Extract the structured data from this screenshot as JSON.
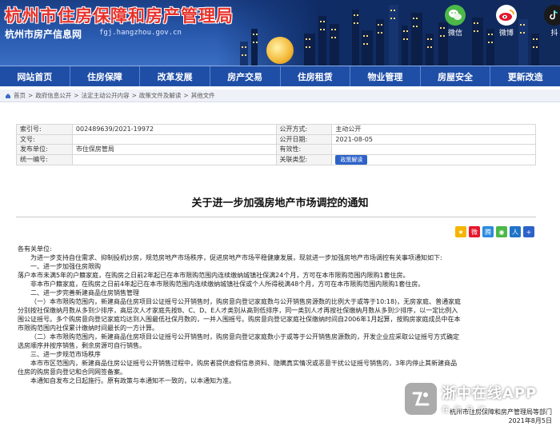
{
  "header": {
    "title": "杭州市住房保障和房产管理局",
    "subtitle": "杭州市房产信息网",
    "url": "fgj.hangzhou.gov.cn",
    "social": [
      {
        "label": "微信",
        "icon": "wechat-icon",
        "color": "#4cb848"
      },
      {
        "label": "微博",
        "icon": "weibo-icon",
        "color": "#e6162d"
      },
      {
        "label": "抖",
        "icon": "douyin-icon",
        "color": "#1a1a1a"
      }
    ]
  },
  "nav": {
    "items": [
      "网站首页",
      "住房保障",
      "改革发展",
      "房产交易",
      "住房租赁",
      "物业管理",
      "房屋安全",
      "更新改造"
    ]
  },
  "breadcrumb": {
    "items": [
      "首页",
      "政府信息公开",
      "法定主动公开内容",
      "政策文件及解读",
      "其他文件"
    ]
  },
  "info": {
    "index_label": "索引号:",
    "index_value": "002489639/2021-19972",
    "public_method_label": "公开方式:",
    "public_method_value": "主动公开",
    "doc_no_label": "文号:",
    "doc_no_value": "",
    "public_date_label": "公开日期:",
    "public_date_value": "2021-08-05",
    "issuer_label": "发布单位:",
    "issuer_value": "市住保房管局",
    "validity_label": "有效性:",
    "validity_value": "",
    "unified_no_label": "统一编号:",
    "unified_no_value": "",
    "related_label": "关联类型:",
    "related_button": "政策解读"
  },
  "doc": {
    "title": "关于进一步加强房地产市场调控的通知",
    "share_icons": [
      "qzone-icon",
      "weibo-icon",
      "tencent-icon",
      "wechat-icon",
      "renren-icon",
      "plus-icon"
    ],
    "paragraphs": [
      "各有关单位:",
      "为进一步支持自住需求、抑制投机炒房，规范房地产市场秩序，促进房地产市场平稳健康发展，现就进一步加强房地产市场调控有关事项通知如下:",
      "一、进一步加强住房限购",
      "落户本市未满5年的户籍家庭，在购房之日前2年起已在本市限购范围内连续缴纳城镇社保满24个月，方可在本市限购范围内限购1套住房。",
      "非本市户籍家庭，在购房之日前4年起已在本市限购范围内连续缴纳城镇社保或个人所得税满48个月，方可在本市限购范围内限购1套住房。",
      "二、进一步完善新建商品住房销售管理",
      "（一）本市限购范围内，新建商品住房项目公证摇号公开销售时，购房意向登记家庭数与公开销售房源数的比例大于或等于10:18)，无房家庭、普通家庭",
      "分别按社保缴纳月数从多到少排序，高层次人才家庭先按B、C、D、E人才类别从高到低排序，同一类别人才再按社保缴纳月数从多到少排序，以一定比例入",
      "围公证摇号。多个购房意向登记家庭均达到入围最低社保月数的，一并入围摇号。购房意向登记家庭社保缴纳时间自2006年1月起算，按购房家庭成员中在本",
      "市限购范围内社保累计缴纳时间最长的一方计算。",
      "（二）本市限购范围内，新建商品住房项目公证摇号公开销售时，购房意向登记家庭数小于或等于公开销售房源数的，开发企业应采取公证摇号方式确定",
      "选房顺序并按序销售，剩余房源可自行销售。",
      "三、进一步规范市场秩序",
      "本市市区范围内，新建商品住房公证摇号公开销售过程中，购房者提供虚假信息资料、隐瞒真实情况或恶意干扰公证摇号销售的，3年内停止其新建商品",
      "住房的购房意向登记和合同网签备案。",
      "本通知自发布之日起施行。原有政策与本通知不一致的，以本通知为准。"
    ],
    "sign_org": "杭州市住房保障和房产管理局等部门",
    "sign_date": "2021年8月5日"
  },
  "watermark": {
    "name": "浙中在线APP",
    "slogan": "在你身边"
  }
}
